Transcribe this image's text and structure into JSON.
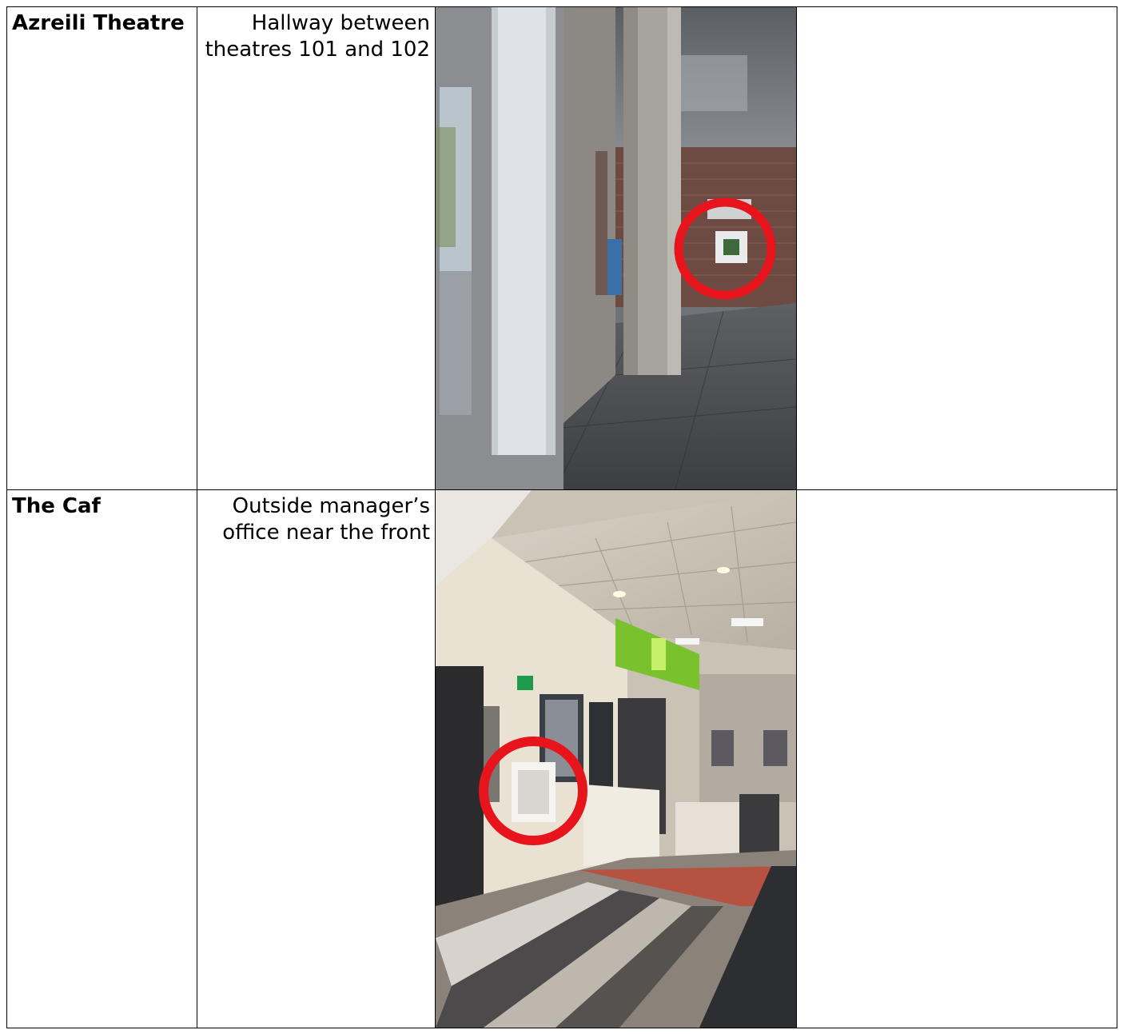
{
  "rows": [
    {
      "location": "Azreili Theatre",
      "description": "Hallway between theatres 101 and 102"
    },
    {
      "location": "The Caf",
      "description": "Outside manager’s office near the front"
    }
  ],
  "colors": {
    "marker": "#e8141b"
  }
}
